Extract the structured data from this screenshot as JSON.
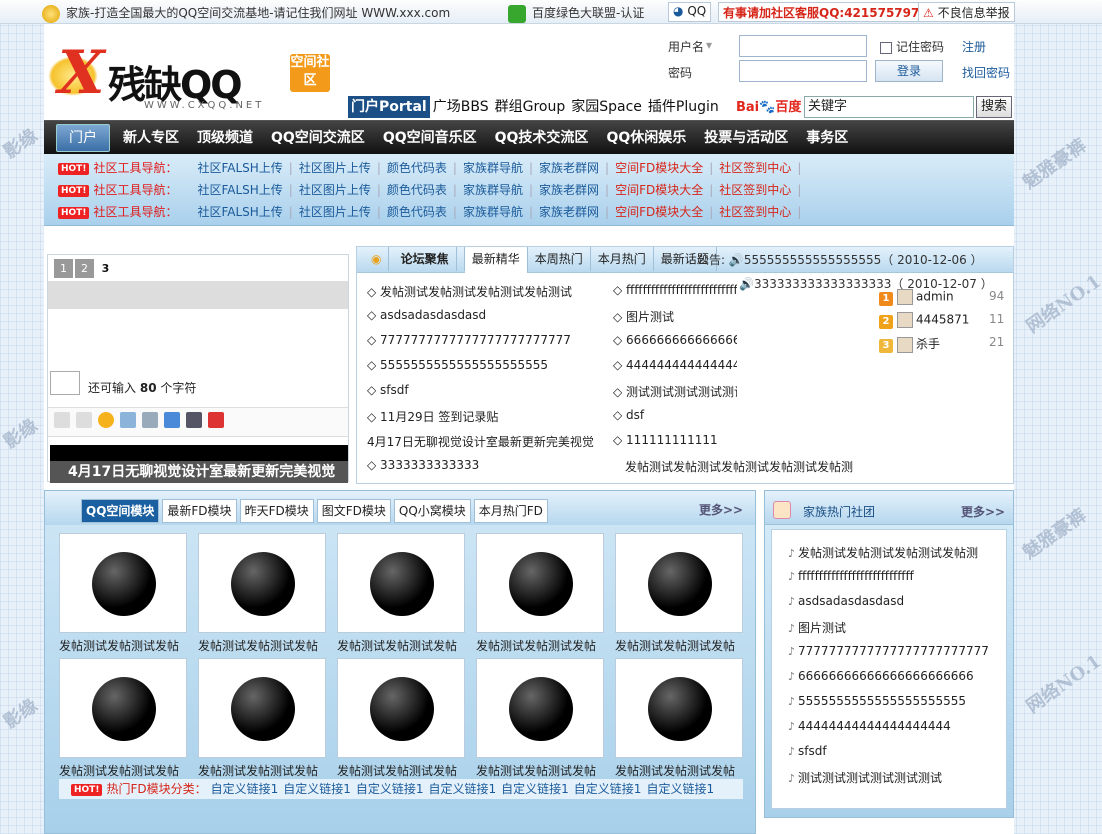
{
  "topbar": {
    "notice": "家族-打造全国最大的QQ空间交流基地-请记住我们网址 WWW.xxx.com",
    "baidu_union": "百度绿色大联盟-认证",
    "qq": "QQ",
    "service": "有事请加社区客服QQ:421575797",
    "report": "不良信息举报"
  },
  "logo": {
    "x": "X",
    "name": "残缺QQ",
    "badge": "空间社区",
    "url": "WWW.CXQQ.NET"
  },
  "login": {
    "username_label": "用户名",
    "password_label": "密码",
    "remember": "记住密码",
    "login_btn": "登录",
    "register": "注册",
    "forgot": "找回密码"
  },
  "portal_tabs": [
    "门户Portal",
    "广场BBS",
    "群组Group",
    "家园Space",
    "插件Plugin"
  ],
  "baidu": {
    "logo_a": "Bai",
    "logo_b": "百度",
    "keyword": "关键字",
    "search": "搜索"
  },
  "nav": [
    "门户",
    "新人专区",
    "顶级频道",
    "QQ空间交流区",
    "QQ空间音乐区",
    "QQ技术交流区",
    "QQ休闲娱乐",
    "投票与活动区",
    "事务区"
  ],
  "subnav": {
    "hot": "HOT!",
    "title": "社区工具导航：",
    "links": [
      "社区FALSH上传",
      "社区图片上传",
      "颜色代码表",
      "家族群导航",
      "家族老群网",
      "空间FD模块大全",
      "社区签到中心"
    ]
  },
  "slider": {
    "pages": [
      "1",
      "2",
      "3"
    ],
    "count_prefix": "还可输入",
    "count_num": "80",
    "count_suffix": "个字符",
    "caption": "4月17日无聊视觉设计室最新更新完美视觉"
  },
  "forum": {
    "tabs": [
      "论坛聚焦",
      "最新精华",
      "本周热门",
      "本月热门",
      "最新话题"
    ],
    "notice_label": "公告:",
    "notice1": "555555555555555555（ 2010-12-06 ）",
    "notice2": "333333333333333333（ 2010-12-07 ）",
    "col1": [
      "◇ 发帖测试发帖测试发帖测试发帖测试",
      "◇ asdsadasdasdasd",
      "◇ 7777777777777777777777777",
      "◇ 5555555555555555555555",
      "◇ sfsdf",
      "◇ 11月29日 签到记录贴",
      "4月17日无聊视觉设计室最新更新完美视觉",
      "◇ 3333333333333"
    ],
    "col2": [
      "◇ ffffffffffffffffffffffffffff",
      "◇ 图片测试",
      "◇ 66666666666666666666666",
      "◇ 44444444444444444444",
      "◇ 测试测试测试测试测试测试",
      "◇ dsf",
      "◇ 111111111111",
      "发帖测试发帖测试发帖测试发帖测试发帖测"
    ],
    "ranks": [
      {
        "n": "1",
        "name": "admin",
        "score": "94"
      },
      {
        "n": "2",
        "name": "4445871",
        "score": "11"
      },
      {
        "n": "3",
        "name": "杀手",
        "score": "21"
      }
    ]
  },
  "mods": {
    "tabs": [
      "QQ空间模块",
      "最新FD模块",
      "昨天FD模块",
      "图文FD模块",
      "QQ小窝模块",
      "本月热门FD"
    ],
    "more": "更多>>",
    "card_caption": "发帖测试发帖测试发帖",
    "foot_hot": "HOT!",
    "foot_title": "热门FD模块分类：",
    "foot_link": "自定义链接1"
  },
  "fam": {
    "title": "家族热门社团",
    "more": "更多>>",
    "items": [
      "发帖测试发帖测试发帖测试发帖测",
      "ffffffffffffffffffffffffffff",
      "asdsadasdasdasd",
      "图片测试",
      "7777777777777777777777777",
      "66666666666666666666666",
      "5555555555555555555555",
      "44444444444444444444",
      "sfsdf",
      "测试测试测试测试测试测试"
    ]
  },
  "watermark": {
    "a": "影缘",
    "b": "魅雅豪裤",
    "c": "网络NO.1"
  },
  "colors": {
    "nav_bg": "#1a1a1a",
    "accent_blue": "#1b5a9a",
    "hot_red": "#e22222"
  }
}
